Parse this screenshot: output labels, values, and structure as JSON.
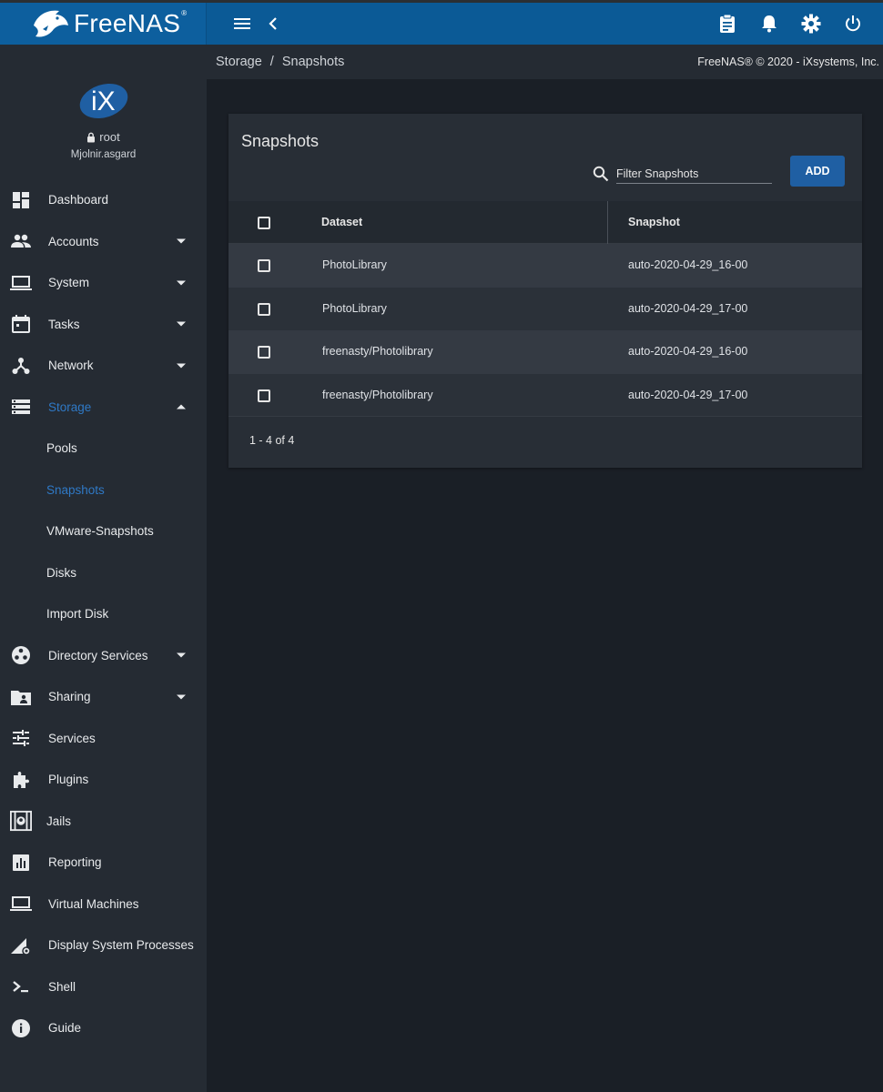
{
  "brand": {
    "name": "FreeNAS",
    "tm": "®"
  },
  "topbar": {
    "icons": [
      "menu-icon",
      "chevron-left-icon",
      "clipboard-icon",
      "bell-icon",
      "gear-icon",
      "power-icon"
    ]
  },
  "profile": {
    "user": "root",
    "host": "Mjolnir.asgard",
    "logo_text": "iX"
  },
  "breadcrumb": {
    "parent": "Storage",
    "separator": "/",
    "current": "Snapshots"
  },
  "copyright": "FreeNAS® © 2020 - iXsystems, Inc.",
  "nav": [
    {
      "label": "Dashboard",
      "icon": "dashboard-icon",
      "caret": "none"
    },
    {
      "label": "Accounts",
      "icon": "people-icon",
      "caret": "down"
    },
    {
      "label": "System",
      "icon": "laptop-icon",
      "caret": "down"
    },
    {
      "label": "Tasks",
      "icon": "calendar-icon",
      "caret": "down"
    },
    {
      "label": "Network",
      "icon": "network-icon",
      "caret": "down"
    },
    {
      "label": "Storage",
      "icon": "storage-icon",
      "caret": "up",
      "active": true
    },
    {
      "label": "Pools",
      "sub": true
    },
    {
      "label": "Snapshots",
      "sub": true,
      "active": true
    },
    {
      "label": "VMware-Snapshots",
      "sub": true
    },
    {
      "label": "Disks",
      "sub": true
    },
    {
      "label": "Import Disk",
      "sub": true
    },
    {
      "label": "Directory Services",
      "icon": "directory-icon",
      "caret": "down"
    },
    {
      "label": "Sharing",
      "icon": "folder-shared-icon",
      "caret": "down"
    },
    {
      "label": "Services",
      "icon": "tune-icon",
      "caret": "none"
    },
    {
      "label": "Plugins",
      "icon": "puzzle-icon",
      "caret": "none"
    },
    {
      "label": "Jails",
      "icon": "jail-icon",
      "caret": "none"
    },
    {
      "label": "Reporting",
      "icon": "chart-icon",
      "caret": "none"
    },
    {
      "label": "Virtual Machines",
      "icon": "laptop-icon",
      "caret": "none"
    },
    {
      "label": "Display System Processes",
      "icon": "processes-icon",
      "caret": "none"
    },
    {
      "label": "Shell",
      "icon": "terminal-icon",
      "caret": "none"
    },
    {
      "label": "Guide",
      "icon": "info-icon",
      "caret": "none"
    }
  ],
  "card": {
    "title": "Snapshots",
    "filter_placeholder": "Filter Snapshots",
    "add_label": "ADD",
    "columns": [
      "Dataset",
      "Snapshot"
    ],
    "rows": [
      {
        "dataset": "PhotoLibrary",
        "snapshot": "auto-2020-04-29_16-00"
      },
      {
        "dataset": "PhotoLibrary",
        "snapshot": "auto-2020-04-29_17-00"
      },
      {
        "dataset": "freenasty/Photolibrary",
        "snapshot": "auto-2020-04-29_16-00"
      },
      {
        "dataset": "freenasty/Photolibrary",
        "snapshot": "auto-2020-04-29_17-00"
      }
    ],
    "pagination": "1 - 4 of 4"
  },
  "colors": {
    "topbar": "#0b5a96",
    "sidebar": "#252b33",
    "background": "#1a1f26",
    "accent": "#2f79c6",
    "button": "#1f5fa3"
  }
}
